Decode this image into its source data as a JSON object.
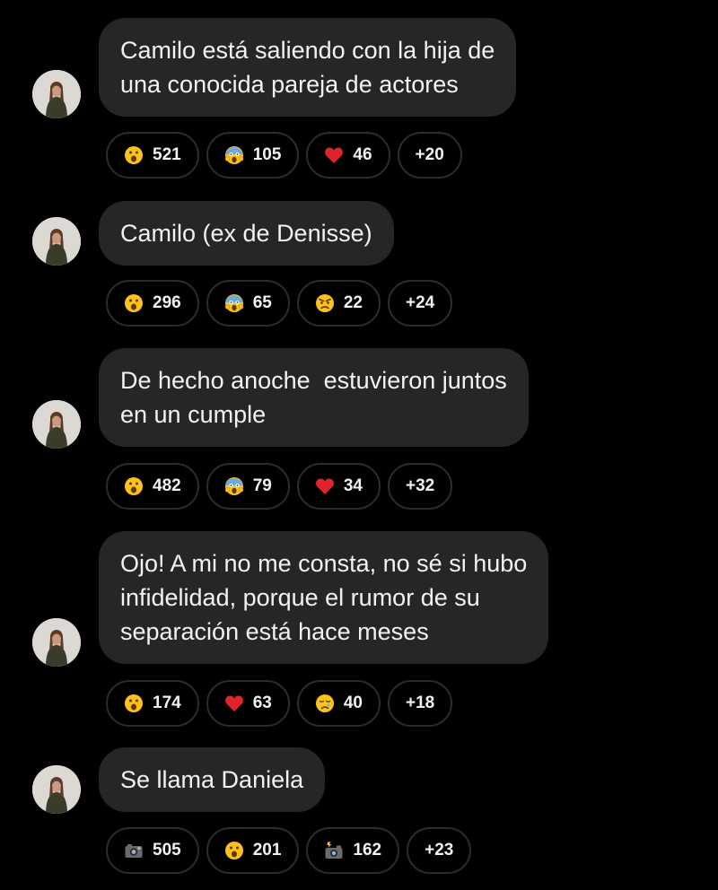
{
  "messages": [
    {
      "lines": [
        "Camilo está saliendo con la hija de",
        "una conocida pareja de actores"
      ],
      "reactions": [
        {
          "icon": "surprised-face",
          "count": "521"
        },
        {
          "icon": "screaming-face",
          "count": "105"
        },
        {
          "icon": "red-heart",
          "count": "46"
        }
      ],
      "more": "+20"
    },
    {
      "lines": [
        "Camilo (ex de Denisse)"
      ],
      "reactions": [
        {
          "icon": "surprised-face",
          "count": "296"
        },
        {
          "icon": "screaming-face",
          "count": "65"
        },
        {
          "icon": "angry-face",
          "count": "22"
        }
      ],
      "more": "+24"
    },
    {
      "lines": [
        "De hecho anoche  estuvieron juntos",
        "en un cumple"
      ],
      "reactions": [
        {
          "icon": "surprised-face",
          "count": "482"
        },
        {
          "icon": "screaming-face",
          "count": "79"
        },
        {
          "icon": "red-heart",
          "count": "34"
        }
      ],
      "more": "+32"
    },
    {
      "lines": [
        "Ojo! A mi no me consta, no sé si hubo",
        "infidelidad, porque el rumor de su",
        "separación está hace meses"
      ],
      "reactions": [
        {
          "icon": "surprised-face",
          "count": "174"
        },
        {
          "icon": "red-heart",
          "count": "63"
        },
        {
          "icon": "crying-face",
          "count": "40"
        }
      ],
      "more": "+18"
    },
    {
      "lines": [
        "Se llama Daniela"
      ],
      "reactions": [
        {
          "icon": "camera",
          "count": "505"
        },
        {
          "icon": "surprised-face",
          "count": "201"
        },
        {
          "icon": "camera-with-flash",
          "count": "162"
        }
      ],
      "more": "+23"
    }
  ],
  "colors": {
    "background": "#000000",
    "bubble": "#262626",
    "pill_border": "#2c2c2c",
    "text": "#f2f2f2"
  }
}
